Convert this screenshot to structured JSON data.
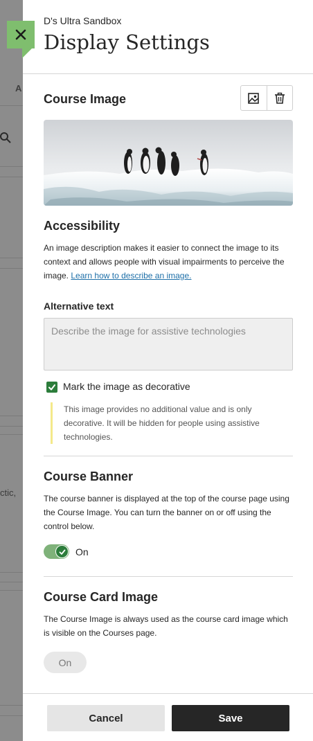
{
  "background": {
    "tab_fragment": "A",
    "text_fragment": "ctic,"
  },
  "close_button": {
    "icon": "close-icon",
    "color": "#7fbe6e"
  },
  "header": {
    "course_name": "D's Ultra Sandbox",
    "title": "Display Settings"
  },
  "course_image": {
    "heading": "Course Image",
    "change_icon": "image-icon",
    "delete_icon": "trash-icon"
  },
  "accessibility": {
    "heading": "Accessibility",
    "description": "An image description makes it easier to connect the image to its context and allows people with visual impairments to perceive the image.",
    "link_text": "Learn how to describe an image.",
    "alt_text_label": "Alternative text",
    "alt_text_placeholder": "Describe the image for assistive technologies",
    "alt_text_value": "",
    "decorative_label": "Mark the image as decorative",
    "decorative_checked": true,
    "decorative_note": "This image provides no additional value and is only decorative. It will be hidden for people using assistive technologies."
  },
  "course_banner": {
    "heading": "Course Banner",
    "description": "The course banner is displayed at the top of the course page using the Course Image. You can turn the banner on or off using the control below.",
    "toggle_label": "On",
    "toggle_on": true
  },
  "course_card_image": {
    "heading": "Course Card Image",
    "description": "The Course Image is always used as the course card image which is visible on the Courses page.",
    "pill_label": "On"
  },
  "footer": {
    "cancel_label": "Cancel",
    "save_label": "Save"
  },
  "colors": {
    "accent_green": "#2c7d3b",
    "link_blue": "#1d6fa8",
    "note_bar": "#f4e98a"
  }
}
